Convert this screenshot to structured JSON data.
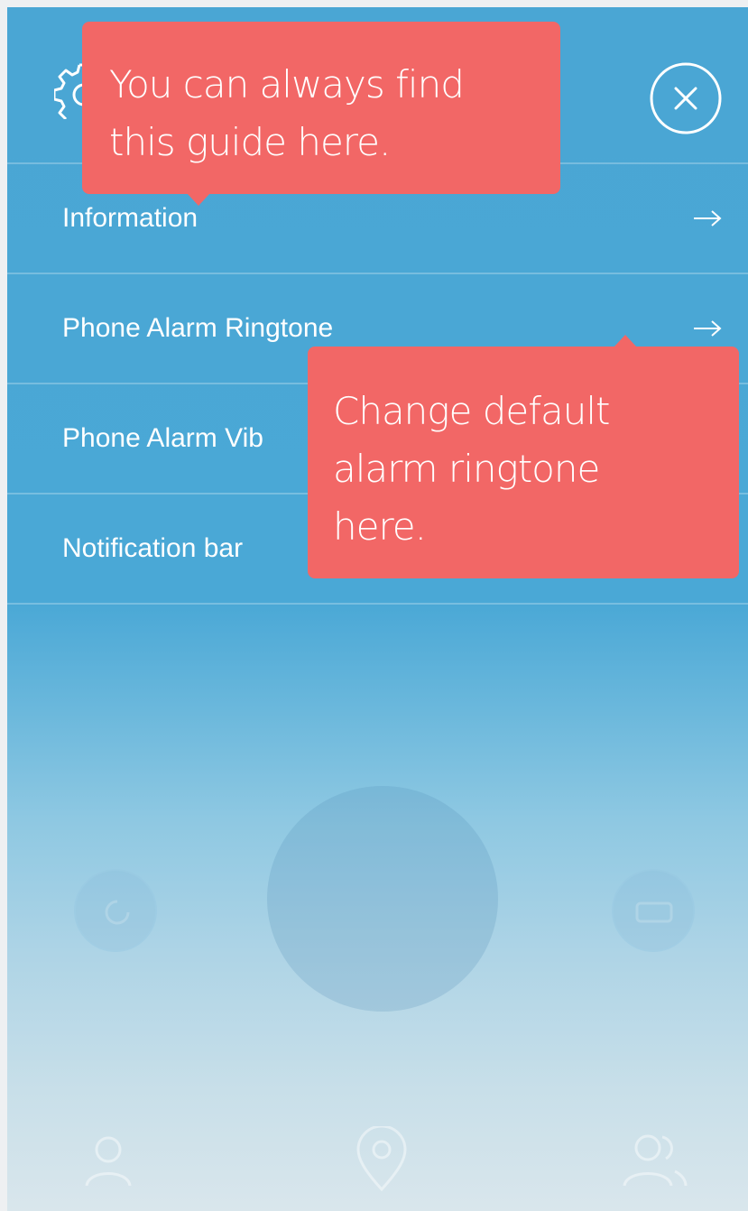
{
  "header": {
    "settings_icon": "gear-icon",
    "close_icon": "close-icon"
  },
  "menu": {
    "items": [
      {
        "label": "Information",
        "icon": "arrow-right-icon"
      },
      {
        "label": "Phone Alarm Ringtone",
        "icon": "arrow-right-icon"
      },
      {
        "label": "Phone Alarm Vib",
        "icon": ""
      },
      {
        "label": "Notification bar",
        "icon": ""
      }
    ]
  },
  "tooltips": {
    "guide": {
      "line1": "You can always find",
      "line2": "this guide here."
    },
    "ringtone": {
      "line1": "Change default",
      "line2": "alarm ringtone",
      "line3": "here."
    }
  },
  "bottom_nav": {
    "icons": [
      "person-icon",
      "location-pin-icon",
      "group-icon"
    ]
  },
  "colors": {
    "background_top": "#4aa6d4",
    "background_bottom": "#d9e6ec",
    "tooltip": "#f26766",
    "text": "#ffffff"
  }
}
